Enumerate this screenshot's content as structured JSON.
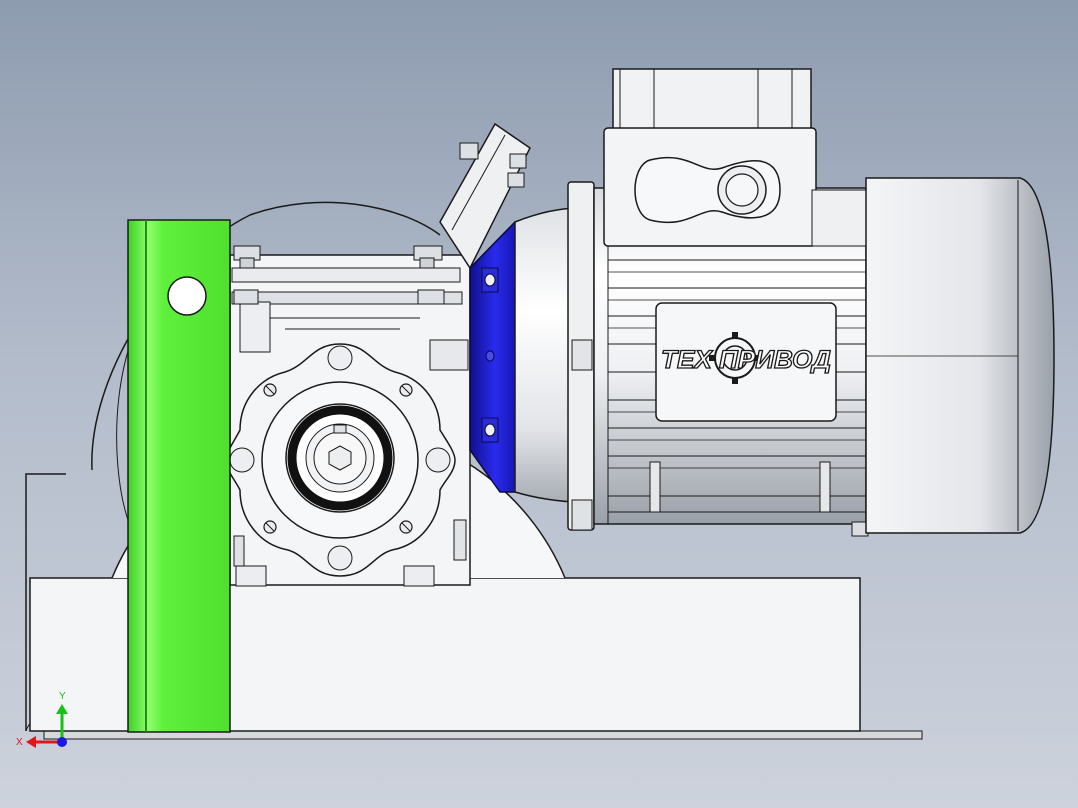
{
  "viewport": {
    "background_top": "#8e9cb0",
    "background_bottom": "#cdd2dc"
  },
  "model": {
    "brand_label": "ТЕХ ПРИВОД",
    "bracket_color": "#5ff03c",
    "flange_color": "#1f1fd6",
    "body_color": "#f2f2f2",
    "edge_color": "#1a1a1a"
  },
  "triad": {
    "x_label": "X",
    "y_label": "Y",
    "x_color": "#e01818",
    "y_color": "#18c018",
    "z_color": "#1818e0"
  }
}
